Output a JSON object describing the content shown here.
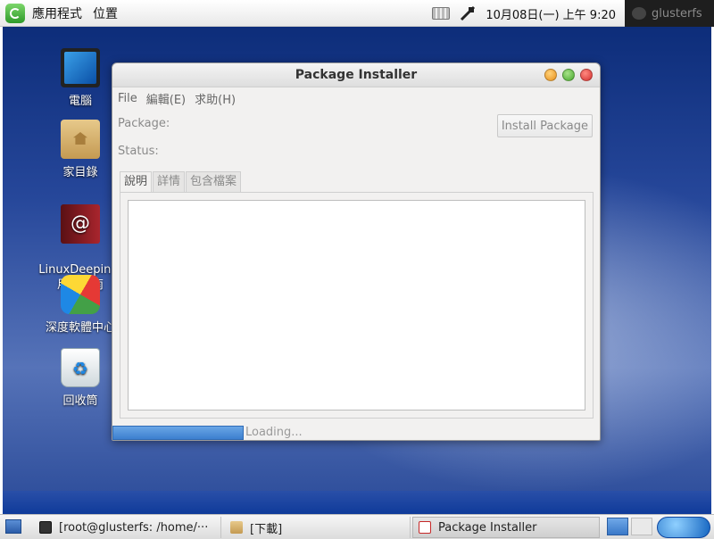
{
  "top_panel": {
    "menu_applications": "應用程式",
    "menu_places": "位置",
    "clock": "10月08日(一) 上午  9:20",
    "username": "glusterfs"
  },
  "desktop": {
    "icons": [
      {
        "label": "電腦",
        "icon": "computer-icon"
      },
      {
        "label": "家目錄",
        "icon": "home-folder-icon"
      },
      {
        "label": "LinuxDeepin 1\n用戶指南",
        "icon": "user-guide-icon"
      },
      {
        "label": "深度軟體中心",
        "icon": "software-center-icon"
      },
      {
        "label": "回收筒",
        "icon": "trash-icon"
      }
    ]
  },
  "window": {
    "title": "Package Installer",
    "menu": [
      "File",
      "編輯(E)",
      "求助(H)"
    ],
    "package_label": "Package:",
    "status_label": "Status:",
    "install_button": "Install Package",
    "tabs": [
      "說明",
      "詳情",
      "包含檔案"
    ],
    "active_tab": 0,
    "progress_fraction": 0.27,
    "progress_text": "Loading..."
  },
  "taskbar": {
    "tasks": [
      {
        "label": "[root@glusterfs: /home/···",
        "icon": "terminal-icon"
      },
      {
        "label": "[下載]",
        "icon": "folder-icon"
      },
      {
        "label": "Package Installer",
        "icon": "package-icon"
      }
    ]
  },
  "colors": {
    "desktop_top": "#0d2d7a",
    "desktop_mid": "#5673b8",
    "progress": "#3c7fcf",
    "close": "#d32f2f",
    "minimize": "#e88f1a",
    "maximize": "#46a82c"
  }
}
